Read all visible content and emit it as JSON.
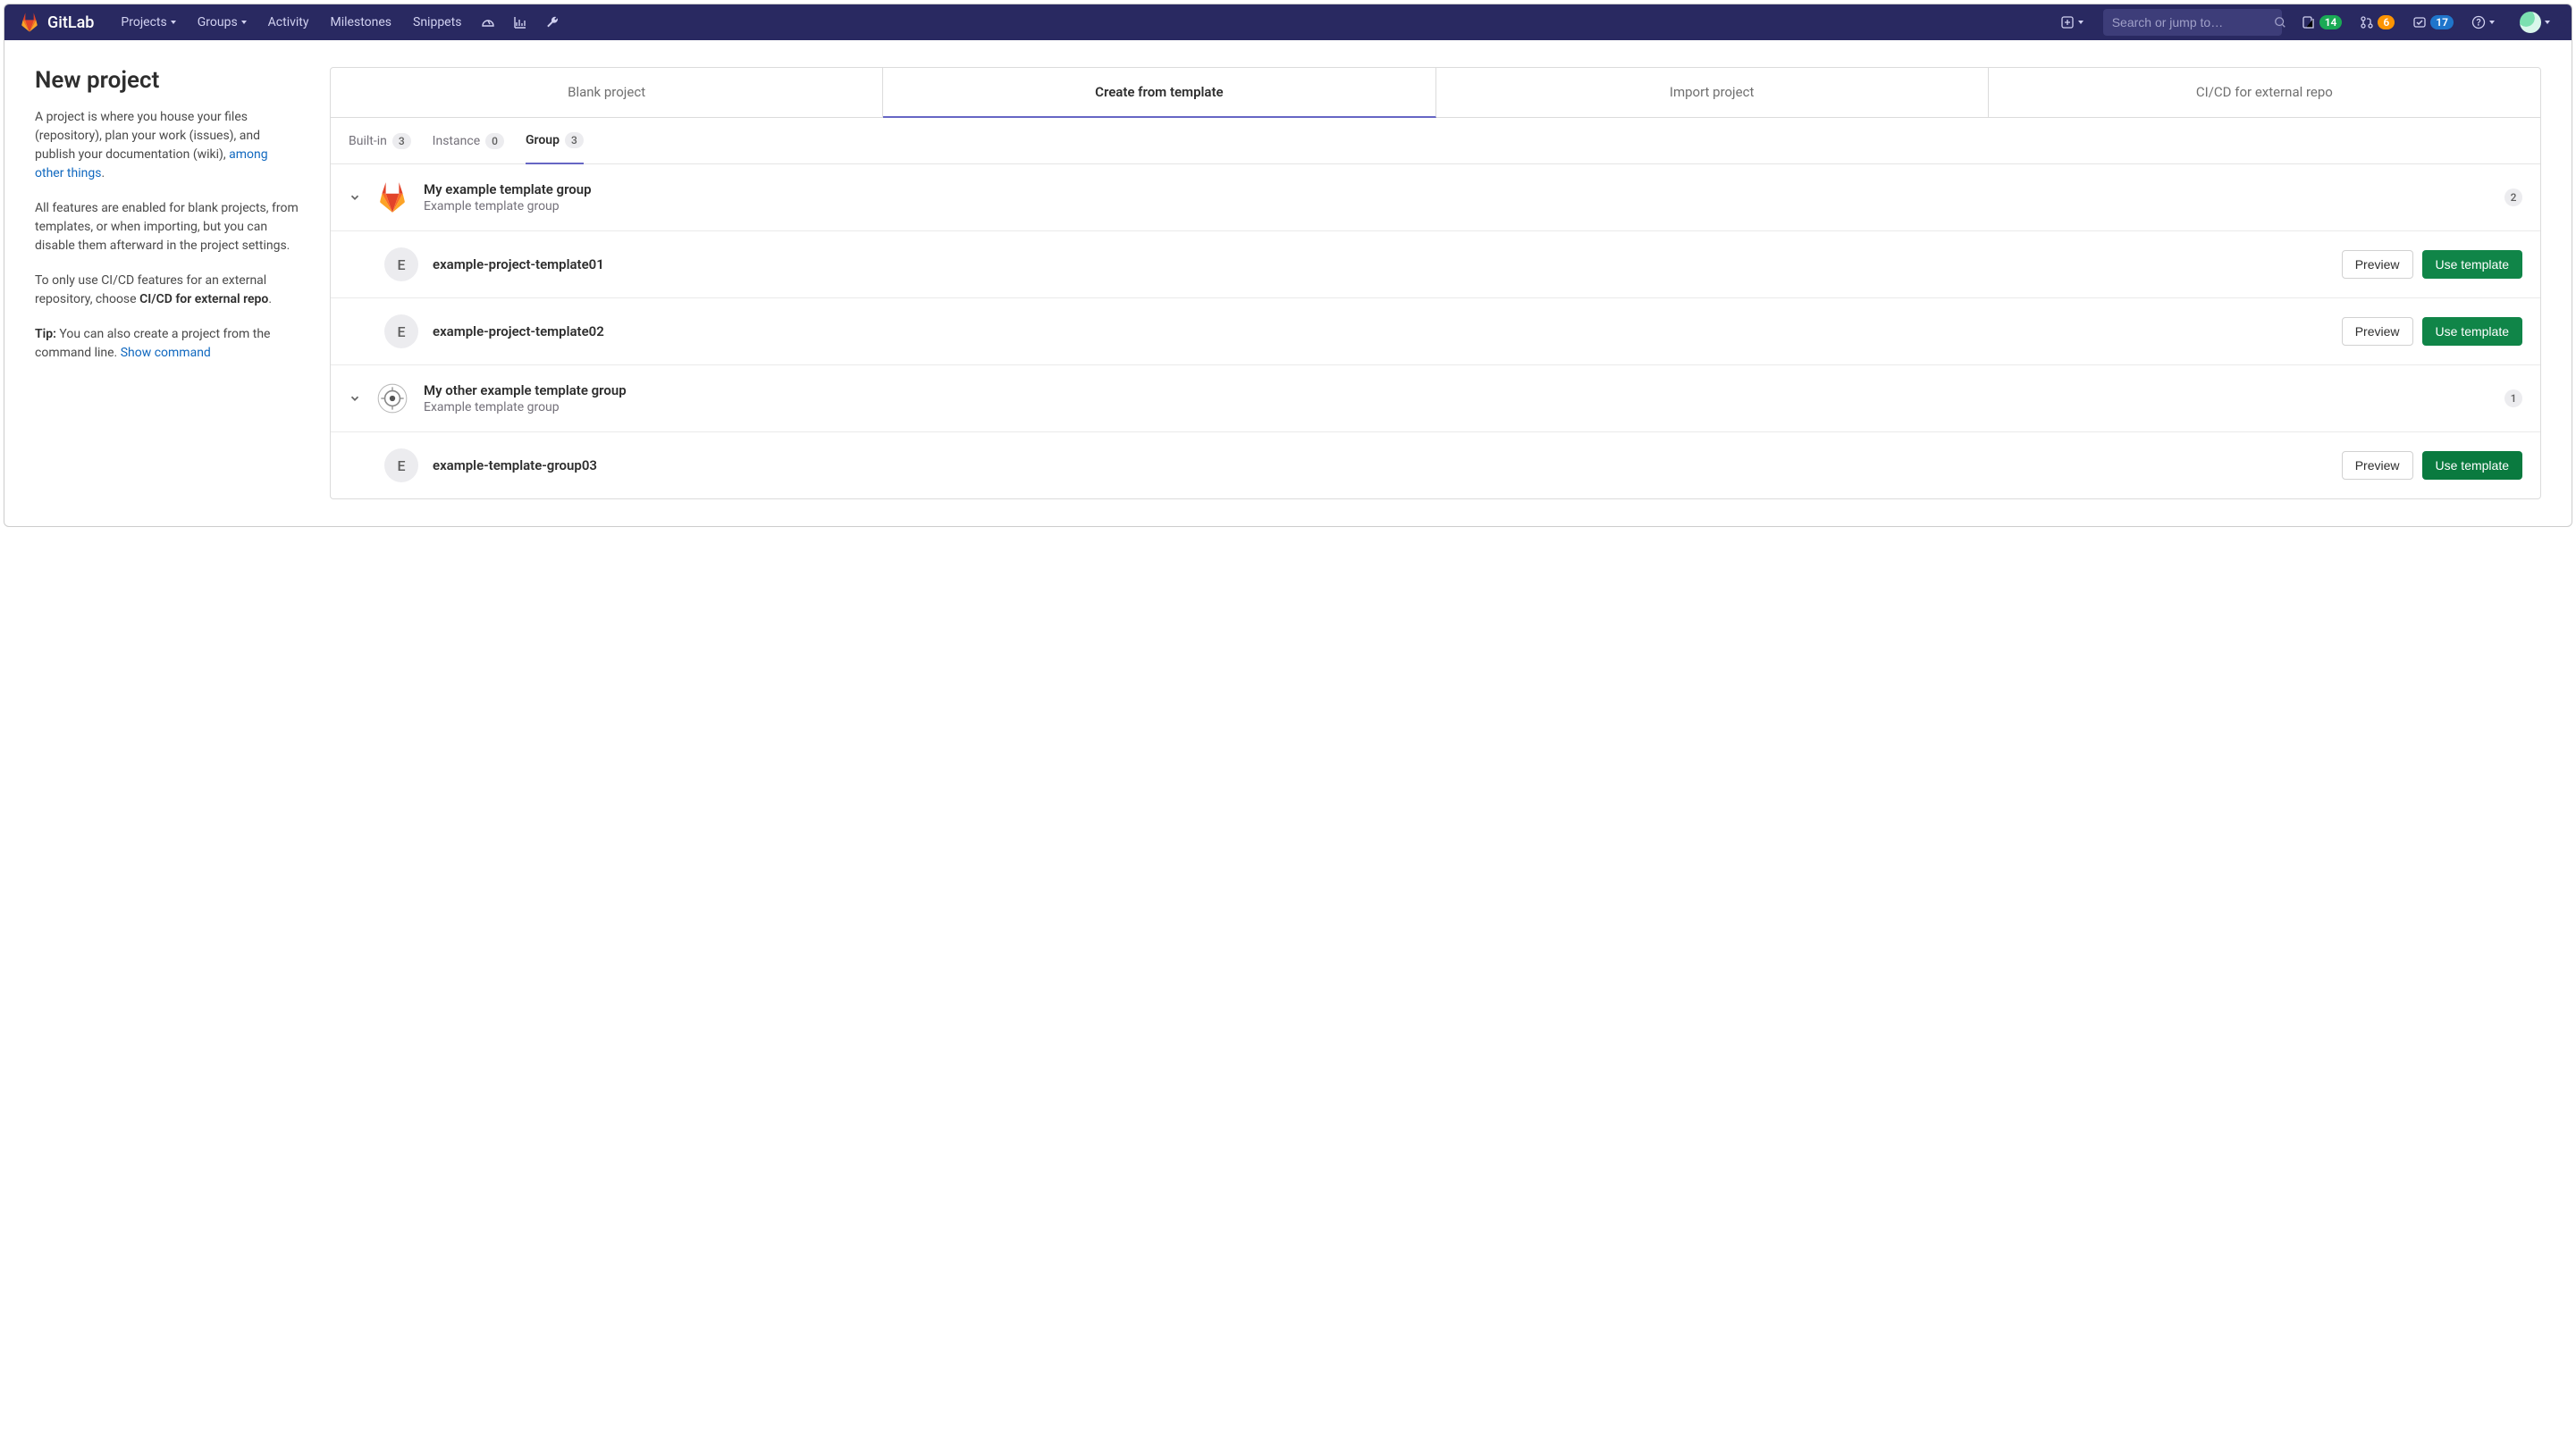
{
  "navbar": {
    "brand": "GitLab",
    "items": [
      "Projects",
      "Groups",
      "Activity",
      "Milestones",
      "Snippets"
    ],
    "search_placeholder": "Search or jump to…",
    "counters": {
      "issues": "14",
      "merge": "6",
      "todos": "17"
    }
  },
  "intro": {
    "title": "New project",
    "p1a": "A project is where you house your files (repository), plan your work (issues), and publish your documentation (wiki), ",
    "p1b": "among other things",
    "p1c": ".",
    "p2": "All features are enabled for blank projects, from templates, or when importing, but you can disable them afterward in the project settings.",
    "p3a": "To only use CI/CD features for an external repository, choose ",
    "p3b": "CI/CD for external repo",
    "p3c": ".",
    "p4a": "Tip:",
    "p4b": " You can also create a project from the command line. ",
    "p4c": "Show command"
  },
  "big_tabs": [
    "Blank project",
    "Create from template",
    "Import project",
    "CI/CD for external repo"
  ],
  "sub_tabs": {
    "builtin": {
      "label": "Built-in",
      "count": "3"
    },
    "instance": {
      "label": "Instance",
      "count": "0"
    },
    "group": {
      "label": "Group",
      "count": "3"
    }
  },
  "buttons": {
    "preview": "Preview",
    "use": "Use template"
  },
  "groups": [
    {
      "name": "My example template group",
      "desc": "Example template group",
      "count": "2",
      "icon": "gitlab",
      "templates": [
        {
          "initial": "E",
          "name": "example-project-template01"
        },
        {
          "initial": "E",
          "name": "example-project-template02"
        }
      ]
    },
    {
      "name": "My other example template group",
      "desc": "Example template group",
      "count": "1",
      "icon": "custom",
      "templates": [
        {
          "initial": "E",
          "name": "example-template-group03"
        }
      ]
    }
  ]
}
